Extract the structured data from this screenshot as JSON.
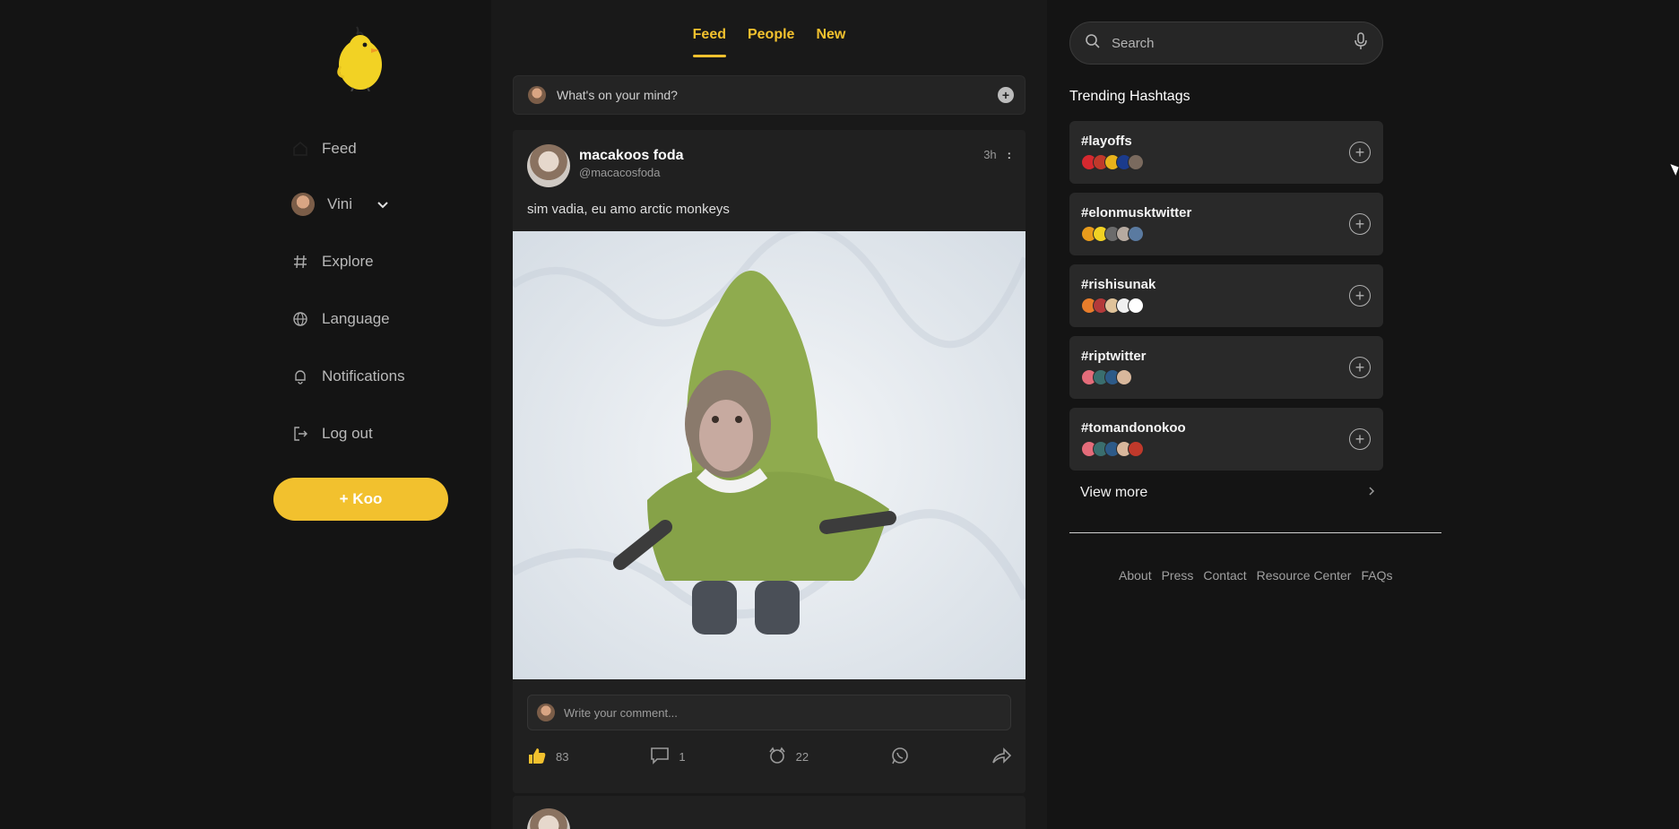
{
  "app": {
    "name": "Koo",
    "accent": "#f2c12e"
  },
  "sidebar": {
    "items": [
      {
        "label": "Feed",
        "icon": "home-icon"
      },
      {
        "label": "Vini",
        "icon": "avatar"
      },
      {
        "label": "Explore",
        "icon": "hashtag-icon"
      },
      {
        "label": "Language",
        "icon": "globe-icon"
      },
      {
        "label": "Notifications",
        "icon": "bell-icon"
      },
      {
        "label": "Log out",
        "icon": "logout-icon"
      }
    ],
    "koo_button": "+ Koo"
  },
  "tabs": [
    {
      "label": "Feed",
      "active": true
    },
    {
      "label": "People",
      "active": false
    },
    {
      "label": "New",
      "active": false
    }
  ],
  "composer": {
    "placeholder": "What's on your mind?"
  },
  "post": {
    "name": "macakoos foda",
    "handle": "@macacosfoda",
    "time": "3h",
    "more": ":",
    "text": "sim vadia, eu amo arctic monkeys",
    "comment_placeholder": "Write your comment...",
    "likes": "83",
    "comments": "1",
    "rekoos": "22"
  },
  "search": {
    "placeholder": "Search"
  },
  "trending": {
    "title": "Trending Hashtags",
    "tags": [
      "#layoffs",
      "#elonmusktwitter",
      "#rishisunak",
      "#riptwitter",
      "#tomandonokoo"
    ],
    "view_more": "View more"
  },
  "footer": {
    "links": [
      "About",
      "Press",
      "Contact",
      "Resource Center",
      "FAQs"
    ]
  }
}
